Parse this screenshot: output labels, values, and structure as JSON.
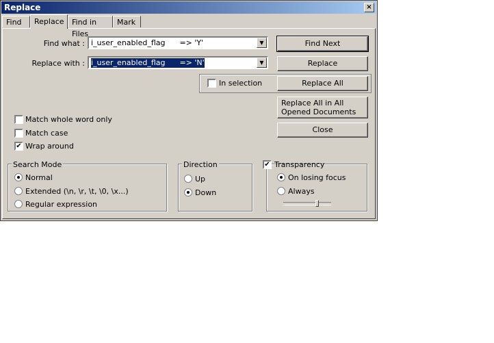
{
  "window": {
    "title": "Replace",
    "close_label": "×"
  },
  "tabs": [
    {
      "label": "Find"
    },
    {
      "label": "Replace"
    },
    {
      "label": "Find in Files"
    },
    {
      "label": "Mark"
    }
  ],
  "find": {
    "label": "Find what :",
    "value": "i_user_enabled_flag      => 'Y'"
  },
  "replace": {
    "label": "Replace with :",
    "value": "i_user_enabled_flag      => 'N'"
  },
  "buttons": {
    "find_next": "Find Next",
    "replace": "Replace",
    "replace_all": "Replace All",
    "replace_all_opened": "Replace All in All Opened Documents",
    "close": "Close"
  },
  "in_selection": {
    "label": "In selection",
    "checked": false
  },
  "options": {
    "match_whole_word": {
      "label": "Match whole word only",
      "checked": false
    },
    "match_case": {
      "label": "Match case",
      "checked": false
    },
    "wrap_around": {
      "label": "Wrap around",
      "checked": true
    }
  },
  "search_mode": {
    "title": "Search Mode",
    "options": [
      "Normal",
      "Extended (\\n, \\r, \\t, \\0, \\x...)",
      "Regular expression"
    ],
    "selected": "Normal"
  },
  "direction": {
    "title": "Direction",
    "options": [
      "Up",
      "Down"
    ],
    "selected": "Down"
  },
  "transparency": {
    "title": "Transparency",
    "checked": true,
    "options": [
      "On losing focus",
      "Always"
    ],
    "selected": "On losing focus",
    "level": 0.7
  }
}
